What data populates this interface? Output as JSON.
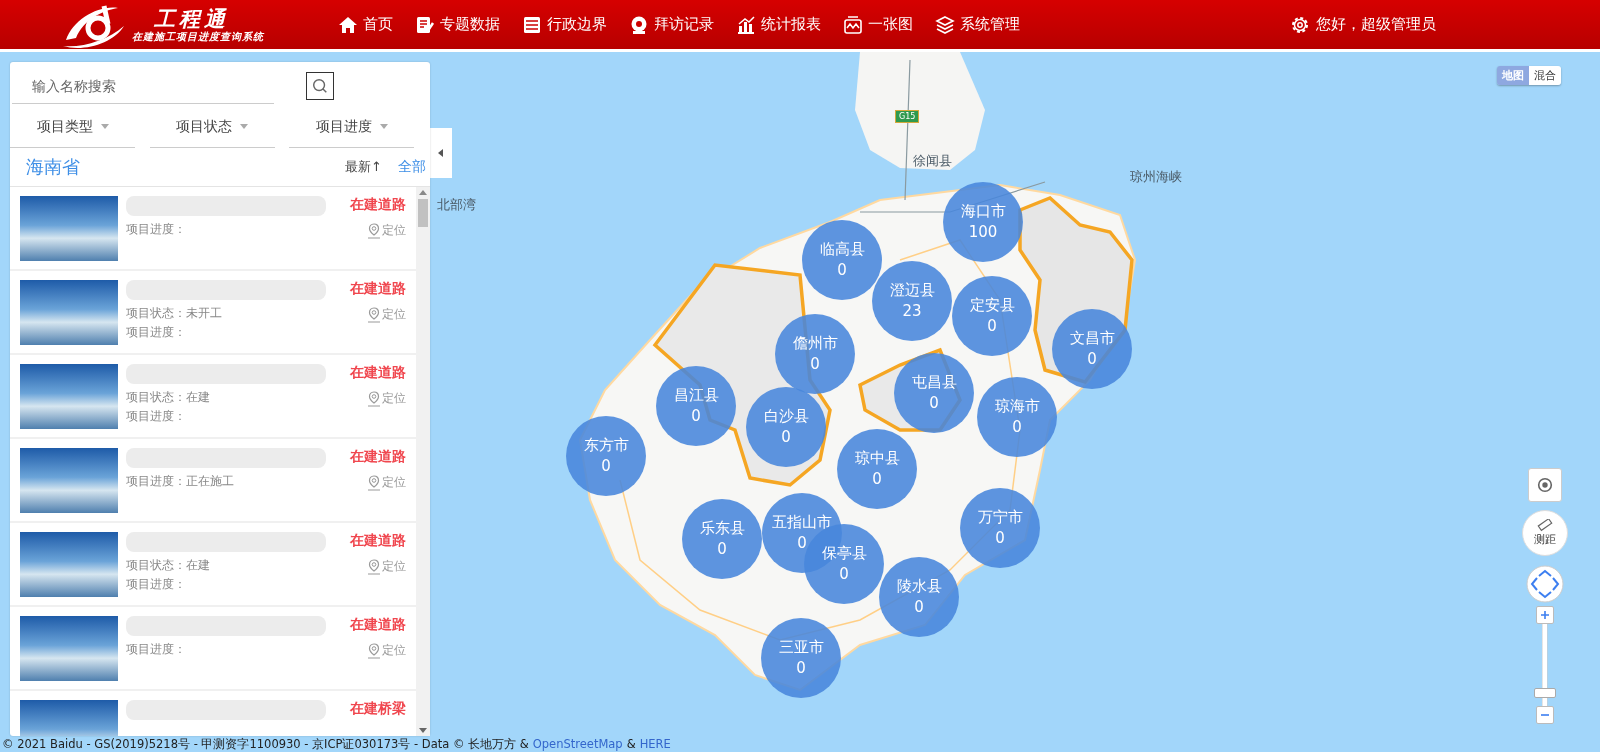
{
  "header": {
    "logo_title": "工程通",
    "logo_subtitle": "在建施工项目进度查询系统",
    "nav": [
      {
        "label": "首页"
      },
      {
        "label": "专题数据"
      },
      {
        "label": "行政边界"
      },
      {
        "label": "拜访记录"
      },
      {
        "label": "统计报表"
      },
      {
        "label": "一张图"
      },
      {
        "label": "系统管理"
      }
    ],
    "user": "您好，超级管理员"
  },
  "panel": {
    "search": {
      "placeholder": "输入名称搜索"
    },
    "filters": [
      {
        "label": "项目类型"
      },
      {
        "label": "项目状态"
      },
      {
        "label": "项目进度"
      }
    ],
    "region": "海南省",
    "sort": "最新↑",
    "all_link": "全部",
    "items": [
      {
        "category": "在建道路",
        "locate": "定位",
        "lines": [
          {
            "label": "项目进度："
          }
        ]
      },
      {
        "category": "在建道路",
        "locate": "定位",
        "lines": [
          {
            "label": "项目状态：",
            "value": "未开工"
          },
          {
            "label": "项目进度："
          }
        ]
      },
      {
        "category": "在建道路",
        "locate": "定位",
        "lines": [
          {
            "label": "项目状态：",
            "value": "在建"
          },
          {
            "label": "项目进度："
          }
        ]
      },
      {
        "category": "在建道路",
        "locate": "定位",
        "lines": [
          {
            "label": "项目进度：",
            "value": "正在施工"
          }
        ]
      },
      {
        "category": "在建道路",
        "locate": "定位",
        "lines": [
          {
            "label": "项目状态：",
            "value": "在建"
          },
          {
            "label": "项目进度："
          }
        ]
      },
      {
        "category": "在建道路",
        "locate": "定位",
        "lines": [
          {
            "label": "项目进度："
          }
        ]
      },
      {
        "category": "在建桥梁"
      }
    ]
  },
  "map": {
    "map_types": [
      {
        "label": "地图",
        "selected": true
      },
      {
        "label": "混合",
        "selected": false
      }
    ],
    "labels": [
      "北部湾",
      "琼州海峡",
      "徐闻县"
    ],
    "road_badge": "G15",
    "clusters": [
      {
        "name": "海口市",
        "count": "100"
      },
      {
        "name": "临高县",
        "count": "0"
      },
      {
        "name": "澄迈县",
        "count": "23"
      },
      {
        "name": "定安县",
        "count": "0"
      },
      {
        "name": "儋州市",
        "count": "0"
      },
      {
        "name": "文昌市",
        "count": "0"
      },
      {
        "name": "昌江县",
        "count": "0"
      },
      {
        "name": "屯昌县",
        "count": "0"
      },
      {
        "name": "白沙县",
        "count": "0"
      },
      {
        "name": "琼海市",
        "count": "0"
      },
      {
        "name": "东方市",
        "count": "0"
      },
      {
        "name": "琼中县",
        "count": "0"
      },
      {
        "name": "万宁市",
        "count": "0"
      },
      {
        "name": "乐东县",
        "count": "0"
      },
      {
        "name": "五指山市",
        "count": "0"
      },
      {
        "name": "保亭县",
        "count": "0"
      },
      {
        "name": "陵水县",
        "count": "0"
      },
      {
        "name": "三亚市",
        "count": "0"
      }
    ],
    "measure": "测距",
    "zoom": {
      "level": 0.1
    },
    "attribution": {
      "text": "© 2021 Baidu - GS(2019)5218号 - 甲测资字1100930 - 京ICP证030173号 - Data © 长地万方 &",
      "links": [
        "OpenStreetMap",
        "HERE"
      ],
      "joiner": "&"
    }
  }
}
